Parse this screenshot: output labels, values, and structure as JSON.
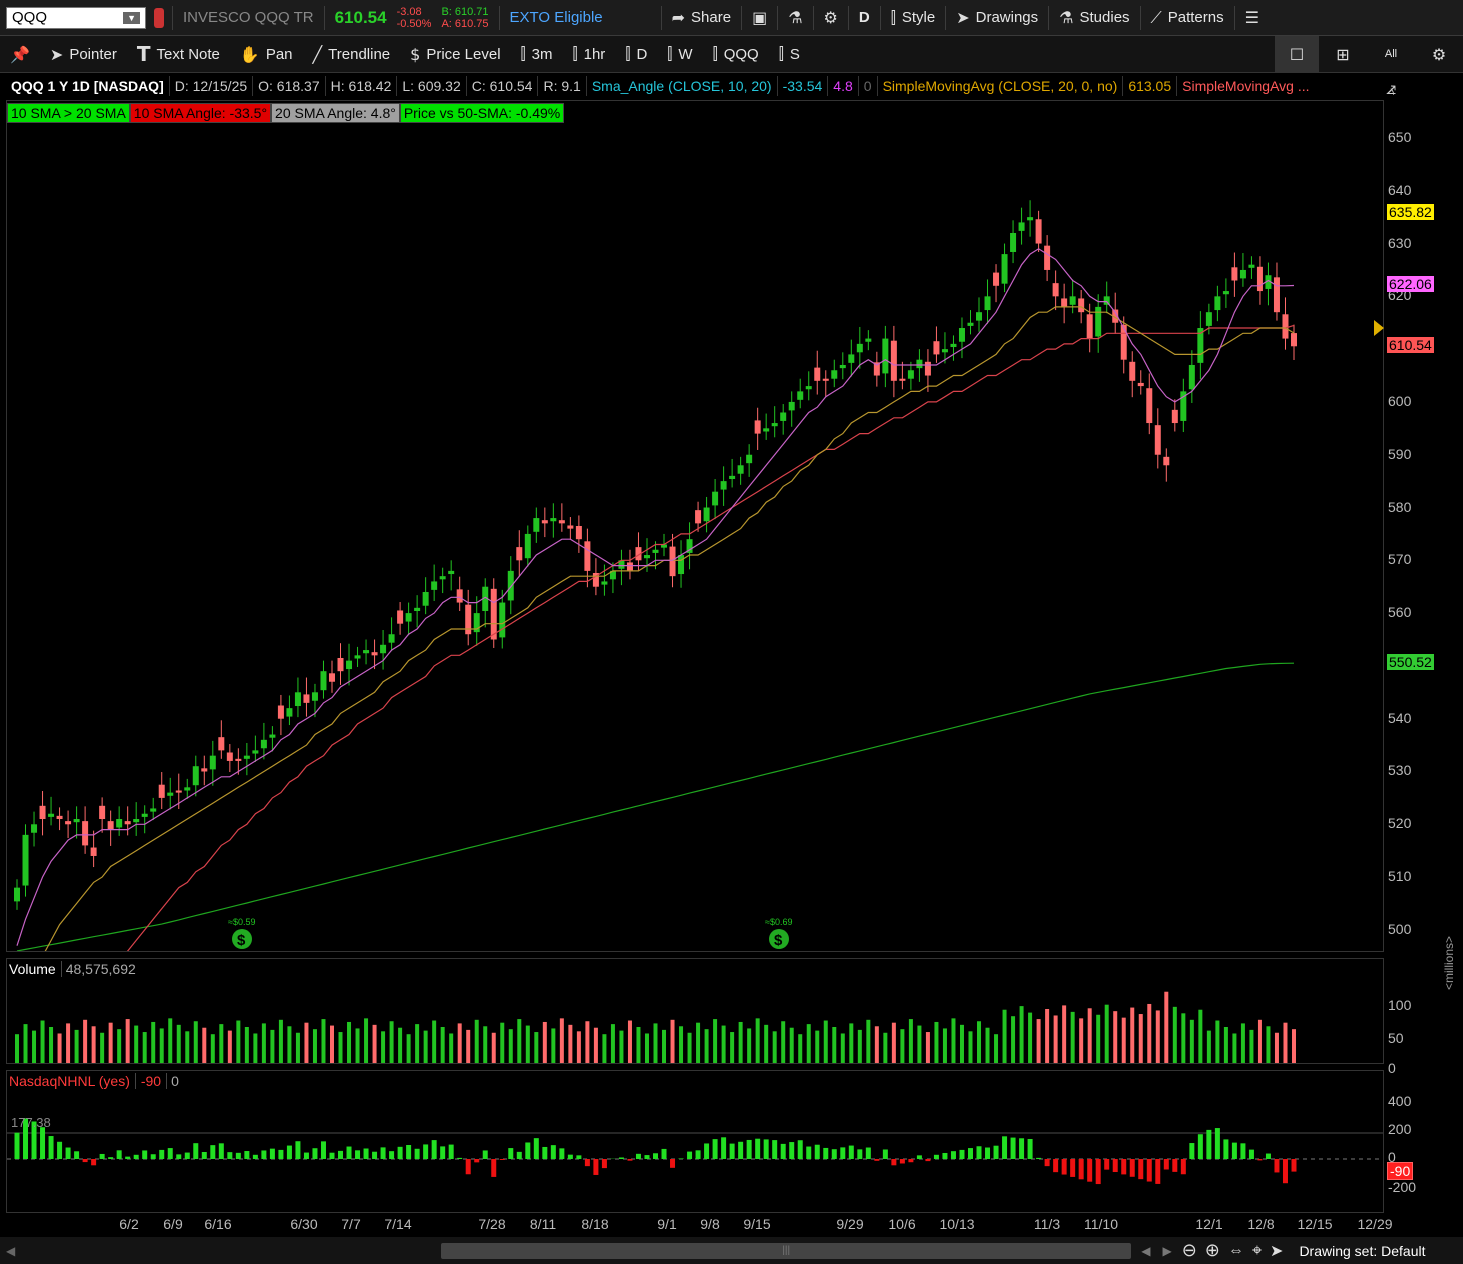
{
  "top": {
    "symbol": "QQQ",
    "name": "INVESCO QQQ TR",
    "last": "610.54",
    "chg": "-3.08",
    "chg_pct": "-0.50%",
    "bid": "B: 610.71",
    "ask": "A: 610.75",
    "exto": "EXTO Eligible",
    "share": "Share",
    "period": "D",
    "style": "Style",
    "drawings": "Drawings",
    "studies": "Studies",
    "patterns": "Patterns"
  },
  "tools": {
    "pointer": "Pointer",
    "text_note": "Text Note",
    "pan": "Pan",
    "trendline": "Trendline",
    "price_level": "Price Level",
    "t3m": "3m",
    "t1hr": "1hr",
    "tD": "D",
    "tW": "W",
    "tQQQ": "QQQ",
    "tS": "S",
    "all": "All"
  },
  "header": {
    "title": "QQQ 1 Y 1D [NASDAQ]",
    "date": "D: 12/15/25",
    "open": "O: 618.37",
    "high": "H: 618.42",
    "low": "L: 609.32",
    "close": "C: 610.54",
    "range": "R: 9.1",
    "study1": "Sma_Angle (CLOSE, 10, 20)",
    "study1_v1": "-33.54",
    "study1_v2": "4.8",
    "study1_v3": "0",
    "study2": "SimpleMovingAvg (CLOSE, 20, 0, no)",
    "study2_v": "613.05",
    "study3": "SimpleMovingAvg ..."
  },
  "labels": [
    {
      "text": "10 SMA > 20 SMA",
      "color": "#00e000"
    },
    {
      "text": "10 SMA Angle: -33.5°",
      "color": "#e00000"
    },
    {
      "text": "20 SMA Angle: 4.8°",
      "color": "#a0a0a0"
    },
    {
      "text": "Price vs 50-SMA: -0.49%",
      "color": "#00e000"
    }
  ],
  "price_axis": {
    "ticks": [
      "650",
      "640",
      "630",
      "620",
      "610",
      "600",
      "590",
      "580",
      "570",
      "560",
      "550",
      "540",
      "530",
      "520",
      "510",
      "500"
    ],
    "tags": [
      {
        "text": "635.82",
        "color": "#ffee00",
        "price": 635.82
      },
      {
        "text": "622.06",
        "color": "#ff66ff",
        "price": 622.06
      },
      {
        "text": "610.54",
        "color": "#ff5555",
        "price": 610.54
      },
      {
        "text": "550.52",
        "color": "#33cc33",
        "price": 550.52
      }
    ]
  },
  "volume": {
    "label": "Volume",
    "value": "48,575,692",
    "ticks": [
      "100",
      "50",
      "0"
    ],
    "unit": "<millions>"
  },
  "nhnl": {
    "label": "NasdaqNHNL (yes)",
    "v1": "-90",
    "v2": "0",
    "ref": "177.38",
    "ticks": [
      "400",
      "200",
      "0",
      "-200"
    ],
    "tag": "-90"
  },
  "dividends": [
    "≈$0.59",
    "≈$0.69"
  ],
  "xaxis": [
    "6/2",
    "6/9",
    "6/16",
    "6/30",
    "7/7",
    "7/14",
    "7/28",
    "8/11",
    "8/18",
    "9/1",
    "9/8",
    "9/15",
    "9/29",
    "10/6",
    "10/13",
    "11/3",
    "11/10",
    "12/1",
    "12/8",
    "12/15",
    "12/29"
  ],
  "status": "Drawing set: Default",
  "chart_data": {
    "type": "candlestick",
    "title": "QQQ 1 Y 1D [NASDAQ]",
    "ylim": [
      496,
      657
    ],
    "close_last": 610.54,
    "sma10_last": 622.06,
    "sma20_last": 613.05,
    "sma200_last": 550.52,
    "x": [
      "5/12",
      "5/13",
      "5/14",
      "5/15",
      "5/16",
      "5/19",
      "5/20",
      "5/21",
      "5/22",
      "5/23",
      "5/27",
      "5/28",
      "5/29",
      "5/30",
      "6/2",
      "6/3",
      "6/4",
      "6/5",
      "6/6",
      "6/9",
      "6/10",
      "6/11",
      "6/12",
      "6/13",
      "6/16",
      "6/17",
      "6/18",
      "6/20",
      "6/23",
      "6/24",
      "6/25",
      "6/26",
      "6/27",
      "6/30",
      "7/1",
      "7/2",
      "7/3",
      "7/7",
      "7/8",
      "7/9",
      "7/10",
      "7/11",
      "7/14",
      "7/15",
      "7/16",
      "7/17",
      "7/18",
      "7/21",
      "7/22",
      "7/23",
      "7/24",
      "7/25",
      "7/28",
      "7/29",
      "7/30",
      "7/31",
      "8/1",
      "8/4",
      "8/5",
      "8/6",
      "8/7",
      "8/8",
      "8/11",
      "8/12",
      "8/13",
      "8/14",
      "8/15",
      "8/18",
      "8/19",
      "8/20",
      "8/21",
      "8/22",
      "8/25",
      "8/26",
      "8/27",
      "8/28",
      "8/29",
      "9/2",
      "9/3",
      "9/4",
      "9/5",
      "9/8",
      "9/9",
      "9/10",
      "9/11",
      "9/12",
      "9/15",
      "9/16",
      "9/17",
      "9/18",
      "9/19",
      "9/22",
      "9/23",
      "9/24",
      "9/25",
      "9/26",
      "9/29",
      "9/30",
      "10/1",
      "10/2",
      "10/3",
      "10/6",
      "10/7",
      "10/8",
      "10/9",
      "10/10",
      "10/13",
      "10/14",
      "10/15",
      "10/16",
      "10/17",
      "10/20",
      "10/21",
      "10/22",
      "10/23",
      "10/24",
      "10/27",
      "10/28",
      "10/29",
      "10/30",
      "10/31",
      "11/3",
      "11/4",
      "11/5",
      "11/6",
      "11/7",
      "11/10",
      "11/11",
      "11/12",
      "11/13",
      "11/14",
      "11/17",
      "11/18",
      "11/19",
      "11/20",
      "11/21",
      "11/24",
      "11/25",
      "11/26",
      "11/28",
      "12/1",
      "12/2",
      "12/3",
      "12/4",
      "12/5",
      "12/8",
      "12/9",
      "12/10",
      "12/11",
      "12/12",
      "12/15"
    ],
    "close": [
      508,
      518,
      520,
      521,
      522,
      521,
      520,
      521,
      516,
      514,
      521,
      519,
      521,
      520,
      521,
      522,
      523,
      525,
      526,
      526,
      527,
      531,
      530,
      533,
      534,
      532,
      532,
      533,
      534,
      536,
      537,
      540,
      542,
      545,
      543,
      545,
      549,
      547,
      549,
      551,
      552,
      553,
      552,
      554,
      556,
      558,
      560,
      561,
      564,
      566,
      567,
      568,
      562,
      556,
      560,
      565,
      555,
      562,
      568,
      570,
      575,
      578,
      577,
      578,
      577,
      576,
      574,
      568,
      565,
      566,
      568,
      570,
      568,
      570,
      571,
      572,
      573,
      567,
      571,
      574,
      577,
      580,
      583,
      585,
      586,
      588,
      590,
      594,
      595,
      596,
      598,
      600,
      602,
      603,
      604,
      604,
      606,
      607,
      609,
      611,
      612,
      605,
      612,
      604,
      604,
      606,
      608,
      605,
      609,
      610,
      611,
      614,
      615,
      617,
      620,
      622,
      628,
      632,
      634,
      635,
      630,
      625,
      620,
      618,
      620,
      617,
      612,
      618,
      620,
      615,
      608,
      604,
      603,
      596,
      590,
      588,
      596,
      602,
      607,
      614,
      617,
      620,
      621,
      623,
      625,
      626,
      621,
      624,
      617,
      612,
      610.54
    ],
    "sma10": [
      497,
      502,
      506,
      510,
      513,
      515,
      517,
      518,
      518,
      518,
      519,
      519,
      519,
      519,
      520,
      520,
      521,
      522,
      523,
      524,
      525,
      526,
      527,
      528,
      529,
      529,
      530,
      531,
      532,
      533,
      534,
      536,
      537,
      539,
      540,
      541,
      543,
      544,
      546,
      547,
      548,
      549,
      550,
      551,
      553,
      554,
      556,
      557,
      559,
      560,
      562,
      563,
      563,
      562,
      562,
      563,
      562,
      563,
      565,
      567,
      569,
      571,
      572,
      573,
      574,
      574,
      573,
      572,
      571,
      570,
      569,
      569,
      569,
      569,
      569,
      570,
      570,
      570,
      571,
      572,
      573,
      574,
      576,
      578,
      580,
      582,
      584,
      586,
      588,
      590,
      592,
      594,
      596,
      598,
      599,
      601,
      602,
      603,
      605,
      607,
      608,
      607,
      608,
      607,
      607,
      607,
      607,
      607,
      607,
      608,
      609,
      610,
      611,
      613,
      615,
      617,
      620,
      623,
      626,
      628,
      629,
      628,
      627,
      625,
      623,
      622,
      620,
      619,
      619,
      617,
      614,
      611,
      609,
      606,
      603,
      601,
      600,
      601,
      602,
      604,
      606,
      609,
      613,
      617,
      620,
      622,
      622,
      623,
      622,
      622,
      622.06
    ],
    "sma20": [
      485,
      488,
      492,
      495,
      498,
      501,
      503,
      505,
      507,
      509,
      510,
      512,
      513,
      514,
      515,
      516,
      517,
      518,
      519,
      520,
      521,
      522,
      523,
      524,
      525,
      526,
      527,
      528,
      529,
      530,
      531,
      532,
      533,
      534,
      535,
      537,
      538,
      539,
      541,
      542,
      543,
      544,
      545,
      547,
      548,
      549,
      551,
      552,
      553,
      555,
      556,
      557,
      557,
      557,
      557,
      558,
      558,
      558,
      559,
      560,
      561,
      563,
      564,
      565,
      566,
      567,
      567,
      567,
      567,
      567,
      568,
      568,
      568,
      568,
      569,
      569,
      570,
      570,
      570,
      571,
      571,
      572,
      573,
      574,
      575,
      576,
      578,
      579,
      581,
      582,
      584,
      585,
      587,
      588,
      590,
      591,
      593,
      594,
      596,
      597,
      598,
      598,
      599,
      600,
      601,
      602,
      602,
      603,
      603,
      604,
      605,
      605,
      606,
      607,
      608,
      609,
      611,
      612,
      614,
      616,
      617,
      617,
      618,
      618,
      618,
      618,
      617,
      617,
      617,
      616,
      615,
      614,
      613,
      612,
      611,
      610,
      609,
      609,
      609,
      609,
      610,
      610,
      611,
      612,
      613,
      613,
      614,
      614,
      614,
      614,
      613.05
    ],
    "sma50": [
      470,
      472,
      474,
      476,
      478,
      480,
      482,
      484,
      486,
      488,
      490,
      492,
      494,
      496,
      498,
      500,
      502,
      504,
      506,
      508,
      509,
      511,
      512,
      514,
      516,
      517,
      519,
      520,
      522,
      523,
      525,
      526,
      528,
      529,
      531,
      532,
      533,
      535,
      536,
      537,
      539,
      540,
      541,
      542,
      544,
      545,
      546,
      547,
      548,
      550,
      551,
      552,
      552,
      553,
      554,
      555,
      556,
      557,
      558,
      559,
      560,
      561,
      562,
      563,
      564,
      565,
      566,
      566,
      567,
      568,
      569,
      570,
      570,
      571,
      572,
      573,
      573,
      574,
      575,
      575,
      576,
      577,
      578,
      579,
      580,
      581,
      582,
      583,
      584,
      585,
      586,
      587,
      588,
      589,
      590,
      591,
      591,
      592,
      593,
      594,
      594,
      595,
      596,
      597,
      597,
      598,
      599,
      600,
      600,
      601,
      602,
      602,
      603,
      604,
      605,
      605,
      606,
      607,
      608,
      608,
      609,
      610,
      610,
      611,
      611,
      612,
      612,
      612,
      613,
      613,
      613,
      613,
      613,
      613,
      613,
      613,
      613,
      613,
      613,
      613,
      614,
      614,
      614,
      614,
      614,
      614,
      614,
      614,
      614,
      614,
      614.5
    ],
    "sma200": [
      496,
      496.3,
      496.6,
      496.9,
      497.2,
      497.5,
      497.8,
      498.1,
      498.4,
      498.7,
      499,
      499.3,
      499.6,
      499.9,
      500.2,
      500.5,
      500.8,
      501.1,
      501.5,
      501.9,
      502.3,
      502.7,
      503.1,
      503.5,
      503.9,
      504.3,
      504.7,
      505.1,
      505.5,
      505.9,
      506.3,
      506.7,
      507.1,
      507.5,
      507.9,
      508.3,
      508.7,
      509.1,
      509.5,
      509.9,
      510.3,
      510.7,
      511.1,
      511.5,
      511.9,
      512.3,
      512.7,
      513.1,
      513.5,
      513.9,
      514.3,
      514.7,
      515.1,
      515.5,
      515.9,
      516.3,
      516.7,
      517.1,
      517.5,
      517.9,
      518.3,
      518.7,
      519.1,
      519.5,
      519.9,
      520.3,
      520.7,
      521.1,
      521.5,
      521.9,
      522.3,
      522.7,
      523.1,
      523.5,
      523.9,
      524.3,
      524.7,
      525.1,
      525.5,
      525.9,
      526.3,
      526.7,
      527.1,
      527.5,
      527.9,
      528.3,
      528.7,
      529.1,
      529.5,
      529.9,
      530.3,
      530.7,
      531.1,
      531.5,
      531.9,
      532.3,
      532.7,
      533.1,
      533.5,
      533.9,
      534.3,
      534.7,
      535.1,
      535.5,
      535.9,
      536.3,
      536.7,
      537.1,
      537.5,
      537.9,
      538.3,
      538.7,
      539.1,
      539.5,
      539.9,
      540.3,
      540.7,
      541.1,
      541.5,
      541.9,
      542.3,
      542.7,
      543.1,
      543.5,
      543.9,
      544.3,
      544.7,
      545,
      545.3,
      545.6,
      545.9,
      546.2,
      546.5,
      546.8,
      547.1,
      547.4,
      547.7,
      548,
      548.3,
      548.6,
      548.9,
      549.2,
      549.5,
      549.7,
      549.9,
      550.1,
      550.3,
      550.4,
      550.45,
      550.5,
      550.52
    ]
  }
}
